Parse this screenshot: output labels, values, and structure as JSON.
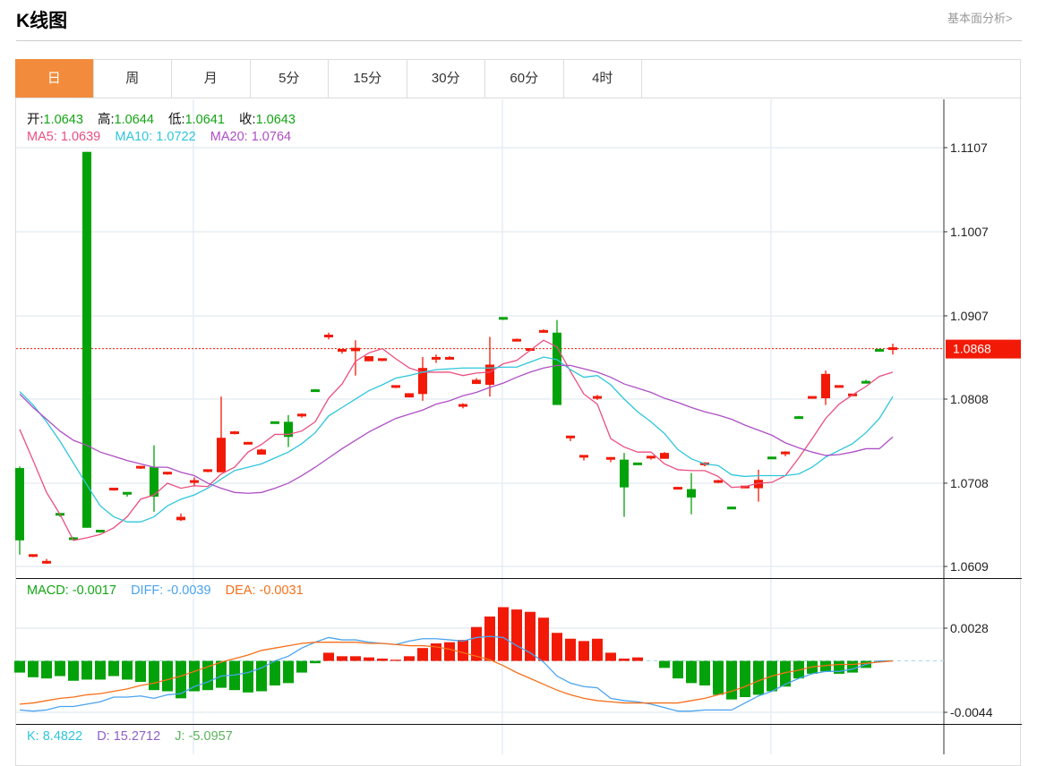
{
  "header": {
    "title": "K线图",
    "fundamental_link": "基本面分析>"
  },
  "tabs": [
    {
      "label": "日",
      "active": true
    },
    {
      "label": "周"
    },
    {
      "label": "月"
    },
    {
      "label": "5分"
    },
    {
      "label": "15分"
    },
    {
      "label": "30分"
    },
    {
      "label": "60分"
    },
    {
      "label": "4时"
    }
  ],
  "ohlc_legend": {
    "open_label": "开:",
    "open": "1.0643",
    "high_label": "高:",
    "high": "1.0644",
    "low_label": "低:",
    "low": "1.0641",
    "close_label": "收:",
    "close": "1.0643"
  },
  "ma_legend": {
    "ma5": "MA5: 1.0639",
    "ma10": "MA10: 1.0722",
    "ma20": "MA20: 1.0764"
  },
  "macd_legend": {
    "macd": "MACD: -0.0017",
    "diff": "DIFF: -0.0039",
    "dea": "DEA: -0.0031"
  },
  "kdj_legend": {
    "k": "K: 8.4822",
    "d": "D: 15.2712",
    "j": "J: -5.0957"
  },
  "colors": {
    "up": "#f21a06",
    "down": "#04a20a",
    "ma5": "#ea4f80",
    "ma10": "#2fc6da",
    "ma20": "#ae4fc4",
    "diff": "#4aa3ef",
    "dea": "#f5701a",
    "tab_active": "#f28c3c"
  },
  "chart_data": [
    {
      "type": "candlestick",
      "title": "K线图",
      "y_ticks": [
        "1.1107",
        "1.1007",
        "1.0907",
        "1.0808",
        "1.0708",
        "1.0609"
      ],
      "ylim": [
        1.0609,
        1.1107
      ],
      "current_price": "1.0868",
      "candles_ohlc": [
        [
          1.0726,
          1.0728,
          1.0623,
          1.064
        ],
        [
          1.0621,
          1.0623,
          1.062,
          1.0623
        ],
        [
          1.0613,
          1.0618,
          1.0612,
          1.0615
        ],
        [
          1.0672,
          1.0672,
          1.0668,
          1.067
        ],
        [
          1.0643,
          1.0644,
          1.064,
          1.0641
        ],
        [
          1.1102,
          1.1102,
          1.0655,
          1.0655
        ],
        [
          1.0652,
          1.0652,
          1.0649,
          1.065
        ],
        [
          1.07,
          1.0702,
          1.0699,
          1.0702
        ],
        [
          1.0697,
          1.0697,
          1.0692,
          1.0695
        ],
        [
          1.0726,
          1.0728,
          1.0725,
          1.0728
        ],
        [
          1.0727,
          1.0753,
          1.0674,
          1.0692
        ],
        [
          1.0719,
          1.0721,
          1.0718,
          1.0721
        ],
        [
          1.0664,
          1.0672,
          1.0663,
          1.0668
        ],
        [
          1.0709,
          1.0715,
          1.0704,
          1.0711
        ],
        [
          1.0722,
          1.0724,
          1.0721,
          1.0724
        ],
        [
          1.0721,
          1.0811,
          1.0721,
          1.0762
        ],
        [
          1.0767,
          1.077,
          1.0766,
          1.0769
        ],
        [
          1.0754,
          1.0757,
          1.0754,
          1.0757
        ],
        [
          1.0742,
          1.0749,
          1.0742,
          1.0748
        ],
        [
          1.0781,
          1.0781,
          1.0779,
          1.0779
        ],
        [
          1.0781,
          1.0789,
          1.0751,
          1.0763
        ],
        [
          1.0788,
          1.0791,
          1.0786,
          1.079
        ],
        [
          1.0819,
          1.082,
          1.0817,
          1.0817
        ],
        [
          1.0882,
          1.0887,
          1.0879,
          1.0884
        ],
        [
          1.0865,
          1.0867,
          1.0862,
          1.0867
        ],
        [
          1.0865,
          1.0878,
          1.0836,
          1.0869
        ],
        [
          1.0853,
          1.0859,
          1.0853,
          1.0859
        ],
        [
          1.0854,
          1.0856,
          1.0853,
          1.0856
        ],
        [
          1.0822,
          1.0824,
          1.0821,
          1.0824
        ],
        [
          1.081,
          1.0815,
          1.081,
          1.0815
        ],
        [
          1.0814,
          1.0858,
          1.0806,
          1.0845
        ],
        [
          1.0855,
          1.0861,
          1.0851,
          1.0858
        ],
        [
          1.0855,
          1.0859,
          1.0855,
          1.0858
        ],
        [
          1.0799,
          1.0803,
          1.0797,
          1.0802
        ],
        [
          1.0826,
          1.0833,
          1.0826,
          1.0831
        ],
        [
          1.0825,
          1.0882,
          1.0811,
          1.0849
        ],
        [
          1.0905,
          1.0905,
          1.0902,
          1.0903
        ],
        [
          1.0877,
          1.088,
          1.0877,
          1.0879
        ],
        [
          1.0866,
          1.0868,
          1.0865,
          1.0868
        ],
        [
          1.0887,
          1.0891,
          1.0887,
          1.089
        ],
        [
          1.0887,
          1.0902,
          1.0801,
          1.0801
        ],
        [
          1.0762,
          1.0764,
          1.0758,
          1.0764
        ],
        [
          1.0739,
          1.0741,
          1.0735,
          1.0741
        ],
        [
          1.0809,
          1.0813,
          1.0807,
          1.0811
        ],
        [
          1.0736,
          1.0739,
          1.0733,
          1.0739
        ],
        [
          1.0736,
          1.0744,
          1.0668,
          1.0703
        ],
        [
          1.0732,
          1.0732,
          1.073,
          1.073
        ],
        [
          1.0738,
          1.074,
          1.0736,
          1.074
        ],
        [
          1.0737,
          1.0745,
          1.0737,
          1.0744
        ],
        [
          1.0701,
          1.0703,
          1.0701,
          1.0703
        ],
        [
          1.0701,
          1.072,
          1.0671,
          1.0691
        ],
        [
          1.073,
          1.0733,
          1.0728,
          1.0732
        ],
        [
          1.0709,
          1.0712,
          1.0708,
          1.0711
        ],
        [
          1.0679,
          1.068,
          1.0677,
          1.0678
        ],
        [
          1.0702,
          1.0705,
          1.0702,
          1.0705
        ],
        [
          1.0702,
          1.0724,
          1.0686,
          1.0712
        ],
        [
          1.0739,
          1.0739,
          1.0737,
          1.0737
        ],
        [
          1.0743,
          1.0746,
          1.074,
          1.0745
        ],
        [
          1.0787,
          1.0788,
          1.0785,
          1.0785
        ],
        [
          1.0809,
          1.0811,
          1.0809,
          1.0811
        ],
        [
          1.0809,
          1.0842,
          1.0801,
          1.0838
        ],
        [
          1.0822,
          1.0824,
          1.0822,
          1.0824
        ],
        [
          1.0812,
          1.0814,
          1.0812,
          1.0814
        ],
        [
          1.0829,
          1.0831,
          1.0827,
          1.0827
        ],
        [
          1.0867,
          1.0868,
          1.0865,
          1.0865
        ],
        [
          1.0867,
          1.0874,
          1.0861,
          1.0869
        ]
      ],
      "series": [
        {
          "name": "MA5",
          "values": [
            1.0772,
            1.0735,
            1.0697,
            1.0671,
            1.064,
            1.0643,
            1.0647,
            1.0655,
            1.0668,
            1.0689,
            1.0694,
            1.0708,
            1.0702,
            1.0705,
            1.0704,
            1.0719,
            1.0727,
            1.0745,
            1.0754,
            1.0766,
            1.0766,
            1.077,
            1.0781,
            1.0809,
            1.0826,
            1.0853,
            1.0863,
            1.0868,
            1.0856,
            1.0845,
            1.084,
            1.084,
            1.084,
            1.0836,
            1.0839,
            1.084,
            1.085,
            1.0854,
            1.0866,
            1.0878,
            1.087,
            1.0841,
            1.0814,
            1.0802,
            1.0761,
            1.0751,
            1.0745,
            1.0745,
            1.0731,
            1.0724,
            1.0723,
            1.0723,
            1.0716,
            1.0703,
            1.0704,
            1.0708,
            1.0709,
            1.0717,
            1.0738,
            1.0761,
            1.0785,
            1.0802,
            1.0813,
            1.0823,
            1.0835,
            1.084
          ]
        },
        {
          "name": "MA10",
          "values": [
            1.0817,
            1.0801,
            1.0781,
            1.0758,
            1.0732,
            1.0706,
            1.0681,
            1.0668,
            1.0662,
            1.0662,
            1.0668,
            1.0681,
            1.0689,
            1.0694,
            1.0702,
            1.0713,
            1.0723,
            1.0727,
            1.0731,
            1.0738,
            1.0745,
            1.0755,
            1.0768,
            1.0788,
            1.0798,
            1.0808,
            1.0818,
            1.0825,
            1.0833,
            1.0836,
            1.084,
            1.0843,
            1.0844,
            1.0845,
            1.0845,
            1.0845,
            1.0846,
            1.0846,
            1.0852,
            1.0858,
            1.0855,
            1.0843,
            1.0834,
            1.0836,
            1.0825,
            1.0808,
            1.0793,
            1.0781,
            1.0767,
            1.0748,
            1.0737,
            1.0731,
            1.0729,
            1.0718,
            1.0716,
            1.0717,
            1.0717,
            1.0717,
            1.0719,
            1.0727,
            1.0739,
            1.0747,
            1.0755,
            1.0768,
            1.0785,
            1.0811
          ]
        },
        {
          "name": "MA20",
          "values": [
            1.0814,
            1.0798,
            1.0784,
            1.077,
            1.0759,
            1.0753,
            1.0745,
            1.074,
            1.0735,
            1.0731,
            1.0727,
            1.0727,
            1.0721,
            1.0717,
            1.0708,
            1.0702,
            1.0697,
            1.0696,
            1.0697,
            1.0702,
            1.0708,
            1.0717,
            1.0727,
            1.0738,
            1.0749,
            1.0759,
            1.0769,
            1.0777,
            1.0785,
            1.079,
            1.0795,
            1.0802,
            1.0806,
            1.0812,
            1.0816,
            1.0822,
            1.0827,
            1.0834,
            1.084,
            1.0845,
            1.0848,
            1.0848,
            1.0844,
            1.084,
            1.0834,
            1.0826,
            1.0821,
            1.0816,
            1.0809,
            1.0804,
            1.0798,
            1.0793,
            1.0789,
            1.0784,
            1.0777,
            1.0771,
            1.0765,
            1.0756,
            1.075,
            1.0745,
            1.0741,
            1.0742,
            1.0745,
            1.0749,
            1.0749,
            1.0763
          ]
        }
      ]
    },
    {
      "type": "bar",
      "title": "MACD",
      "y_ticks": [
        "0.0028",
        "-0.0044"
      ],
      "ylim": [
        -0.0044,
        0.0028
      ],
      "histogram": [
        -0.001,
        -0.0014,
        -0.0015,
        -0.0013,
        -0.0017,
        -0.0016,
        -0.0016,
        -0.0013,
        -0.0016,
        -0.0018,
        -0.0025,
        -0.0026,
        -0.0032,
        -0.0026,
        -0.0025,
        -0.0023,
        -0.0025,
        -0.0027,
        -0.0026,
        -0.0021,
        -0.0019,
        -0.001,
        -0.0002,
        0.0007,
        0.0004,
        0.0004,
        0.0003,
        0.0002,
        0.0001,
        0.0004,
        0.0011,
        0.0015,
        0.0016,
        0.0018,
        0.0029,
        0.0038,
        0.0046,
        0.0044,
        0.0042,
        0.0037,
        0.0024,
        0.0019,
        0.0017,
        0.0019,
        0.0007,
        0.0002,
        0.0003,
        0.0,
        -0.0006,
        -0.0015,
        -0.0019,
        -0.0021,
        -0.0029,
        -0.0033,
        -0.0031,
        -0.0029,
        -0.0026,
        -0.0022,
        -0.0015,
        -0.0011,
        -0.0009,
        -0.0011,
        -0.001,
        -0.0006,
        -0.0001,
        0.0
      ],
      "series": [
        {
          "name": "DIFF",
          "values": [
            -0.0042,
            -0.0043,
            -0.0042,
            -0.0039,
            -0.0039,
            -0.0037,
            -0.0035,
            -0.0031,
            -0.0031,
            -0.003,
            -0.0032,
            -0.0029,
            -0.0028,
            -0.0022,
            -0.0018,
            -0.0013,
            -0.0012,
            -0.001,
            -0.0006,
            0.0,
            0.0004,
            0.0011,
            0.0016,
            0.002,
            0.0018,
            0.0018,
            0.0016,
            0.0015,
            0.0014,
            0.0017,
            0.0019,
            0.0019,
            0.0018,
            0.0017,
            0.002,
            0.0021,
            0.002,
            0.0013,
            0.0007,
            -0.0001,
            -0.0013,
            -0.0019,
            -0.0022,
            -0.0023,
            -0.0032,
            -0.0034,
            -0.0035,
            -0.0037,
            -0.004,
            -0.0043,
            -0.0043,
            -0.0042,
            -0.0042,
            -0.0042,
            -0.0036,
            -0.003,
            -0.0026,
            -0.002,
            -0.0015,
            -0.0011,
            -0.0009,
            -0.0009,
            -0.0007,
            -0.0003,
            0.0,
            0.0
          ]
        },
        {
          "name": "DEA",
          "values": [
            -0.0037,
            -0.0036,
            -0.0034,
            -0.0032,
            -0.0031,
            -0.0029,
            -0.0028,
            -0.0026,
            -0.0024,
            -0.0021,
            -0.0019,
            -0.0016,
            -0.0013,
            -0.0009,
            -0.0005,
            -0.0001,
            0.0002,
            0.0005,
            0.0009,
            0.0011,
            0.0013,
            0.0015,
            0.0016,
            0.0016,
            0.0016,
            0.0016,
            0.0015,
            0.0015,
            0.0014,
            0.0013,
            0.0013,
            0.0012,
            0.001,
            0.0007,
            0.0004,
            0.0001,
            -0.0004,
            -0.001,
            -0.0015,
            -0.002,
            -0.0025,
            -0.0029,
            -0.0032,
            -0.0034,
            -0.0035,
            -0.0036,
            -0.0036,
            -0.0036,
            -0.0036,
            -0.0036,
            -0.0034,
            -0.0032,
            -0.0029,
            -0.0026,
            -0.0022,
            -0.0017,
            -0.0013,
            -0.001,
            -0.0008,
            -0.0005,
            -0.0004,
            -0.0003,
            -0.0003,
            -0.0002,
            -0.0001,
            0.0
          ]
        }
      ]
    }
  ]
}
